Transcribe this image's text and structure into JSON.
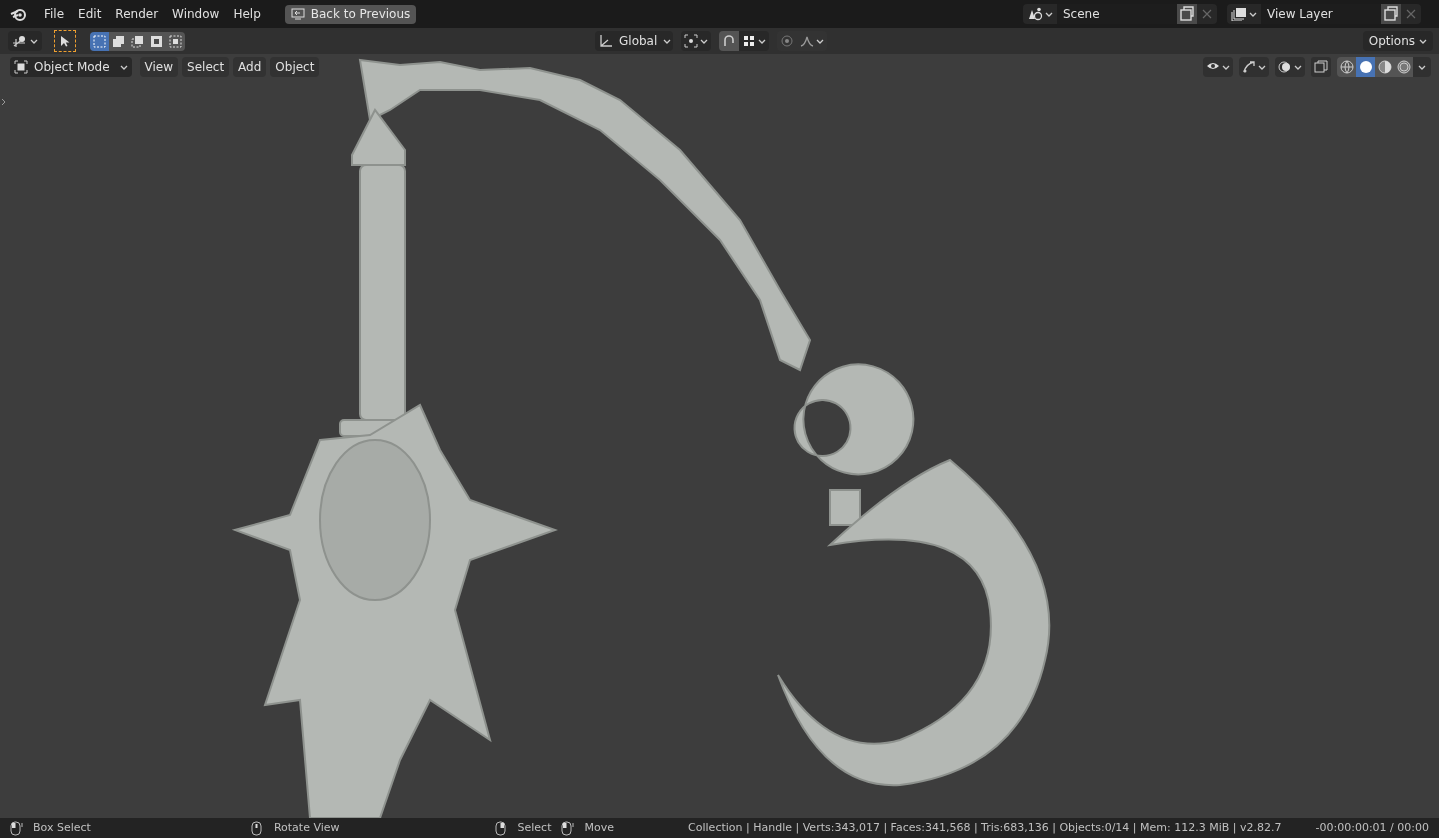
{
  "menu": [
    "File",
    "Edit",
    "Render",
    "Window",
    "Help"
  ],
  "back_button": "Back to Previous",
  "scene": {
    "name": "Scene"
  },
  "view_layer": {
    "name": "View Layer"
  },
  "select_modes": [
    {
      "selected": true
    },
    {
      "selected": false
    },
    {
      "selected": false
    },
    {
      "selected": false
    },
    {
      "selected": false
    }
  ],
  "transform_orientation": "Global",
  "options": "Options",
  "viewport_header": {
    "mode": "Object Mode",
    "menus": [
      "View",
      "Select",
      "Add",
      "Object"
    ]
  },
  "shading_modes": [
    {
      "selected": false
    },
    {
      "selected": true
    },
    {
      "selected": false
    },
    {
      "selected": false
    }
  ],
  "status_bar": {
    "hints": [
      {
        "kind": "left",
        "label": "Box Select"
      },
      {
        "kind": "middle",
        "label": "Rotate View"
      },
      {
        "kind": "right",
        "label": "Select"
      },
      {
        "kind": "left",
        "label": "Move"
      }
    ],
    "stats": "Collection | Handle | Verts:343,017 | Faces:341,568 | Tris:683,136 | Objects:0/14 | Mem: 112.3 MiB | v2.82.7",
    "time": "-00:00:00:01 / 00:00"
  }
}
